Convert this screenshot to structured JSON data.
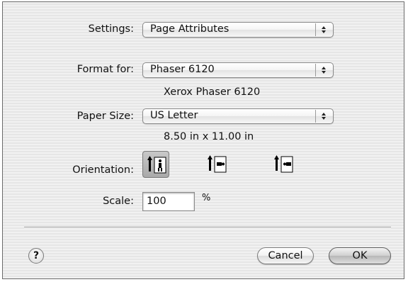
{
  "settings": {
    "label": "Settings:",
    "value": "Page Attributes"
  },
  "format_for": {
    "label": "Format for:",
    "value": "Phaser 6120",
    "description": "Xerox Phaser 6120"
  },
  "paper_size": {
    "label": "Paper Size:",
    "value": "US Letter",
    "dimensions": "8.50 in x 11.00 in"
  },
  "orientation": {
    "label": "Orientation:",
    "options": [
      {
        "name": "portrait",
        "selected": true
      },
      {
        "name": "landscape-left",
        "selected": false
      },
      {
        "name": "landscape-right",
        "selected": false
      }
    ]
  },
  "scale": {
    "label": "Scale:",
    "value": "100",
    "unit": "%"
  },
  "help": {
    "label": "?"
  },
  "buttons": {
    "cancel": "Cancel",
    "ok": "OK"
  }
}
